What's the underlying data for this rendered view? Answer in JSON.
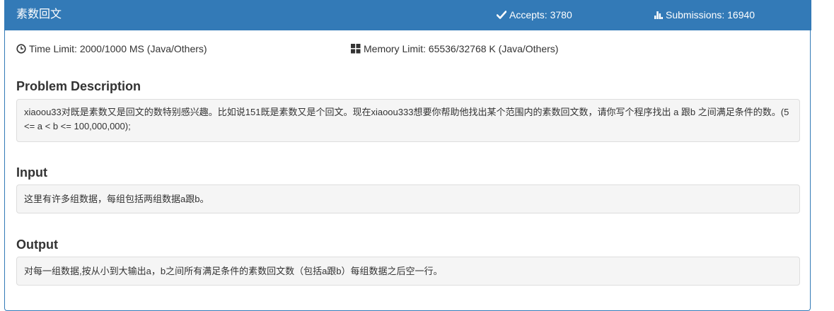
{
  "header": {
    "title": "素数回文",
    "accepts_label": "Accepts: 3780",
    "submissions_label": "Submissions: 16940",
    "accepts_icon": "check-icon",
    "submissions_icon": "bar-chart-icon"
  },
  "limits": {
    "time": "Time Limit: 2000/1000 MS (Java/Others)",
    "memory": "Memory Limit: 65536/32768 K (Java/Others)",
    "time_icon": "clock-icon",
    "memory_icon": "grid-icon"
  },
  "sections": {
    "description": {
      "title": "Problem Description",
      "text": "xiaoou33对既是素数又是回文的数特别感兴趣。比如说151既是素数又是个回文。现在xiaoou333想要你帮助他找出某个范围内的素数回文数，请你写个程序找出 a 跟b 之间满足条件的数。(5 <= a < b <= 100,000,000);"
    },
    "input": {
      "title": "Input",
      "text": "这里有许多组数据，每组包括两组数据a跟b。"
    },
    "output": {
      "title": "Output",
      "text": "对每一组数据,按从小到大输出a，b之间所有满足条件的素数回文数（包括a跟b）每组数据之后空一行。"
    }
  },
  "colors": {
    "header_bg": "#337ab7",
    "box_bg": "#f5f5f5",
    "text": "#333333"
  }
}
